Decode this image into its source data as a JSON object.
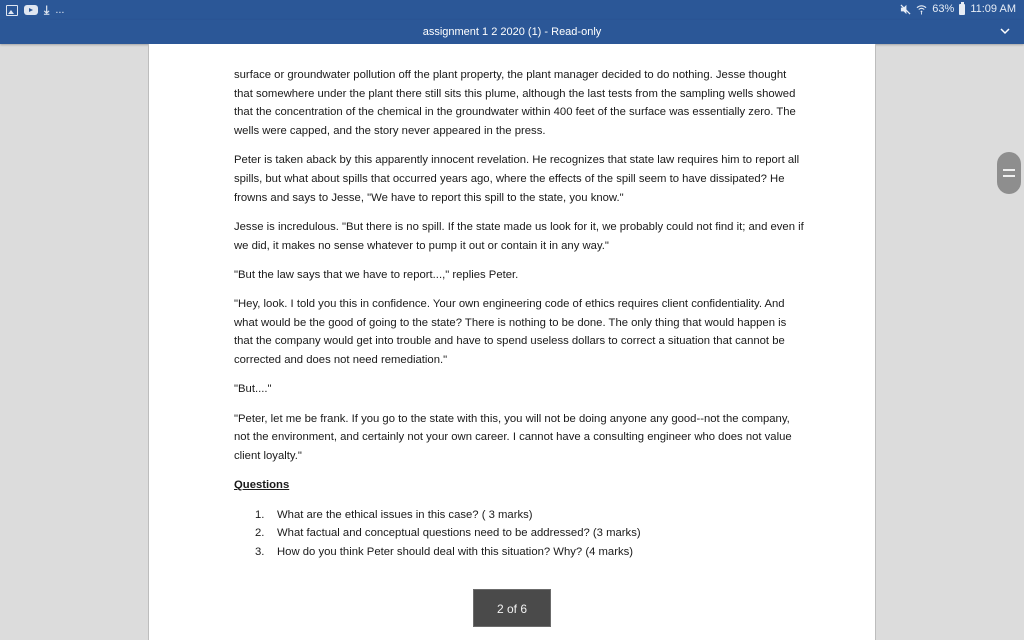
{
  "statusbar": {
    "left_icons": [
      "image-icon",
      "video-icon",
      "download-icon",
      "more-icon"
    ],
    "more_label": "...",
    "mute_glyph": "🔇",
    "battery_percent": "63%",
    "time": "11:09 AM"
  },
  "titlebar": {
    "title": "assignment 1  2 2020 (1) - Read-only"
  },
  "document": {
    "paragraphs": [
      "surface or groundwater pollution off the plant property, the plant manager decided to do nothing. Jesse thought that somewhere under the plant there still sits this plume, although the last tests from the sampling wells showed that the concentration of the chemical in the groundwater within 400 feet of the surface was essentially zero. The wells were capped, and the story never appeared in the press.",
      "Peter is taken aback by this apparently innocent revelation. He recognizes that state law requires him to report all spills, but what about spills that occurred years ago, where the effects of the spill seem to have dissipated? He frowns and says to Jesse, \"We have to report this spill to the state, you know.\"",
      "Jesse is incredulous. \"But there is no spill. If the state made us look for it, we probably could not find it; and even if we did, it makes no sense whatever to pump it out or contain it in any way.\"",
      "\"But the law says that we have to report...,\" replies Peter.",
      "\"Hey, look. I told you this in confidence. Your own engineering code of ethics requires client confidentiality. And what would be the good of going to the state? There is nothing to be done. The only thing that would happen is that the company would get into trouble and have to spend useless dollars to correct a situation that cannot be corrected and does not need remediation.\"",
      "\"But....\"",
      "\"Peter, let me be frank. If you go to the state with this, you will not be doing anyone any good--not the company, not the environment, and certainly not your own career. I cannot have a consulting engineer who does not value client loyalty.\""
    ],
    "questions_heading": "Questions",
    "questions": [
      {
        "num": "1.",
        "text": "What are the ethical issues in this case?  ( 3 marks)"
      },
      {
        "num": "2.",
        "text": "What factual and conceptual questions need to be addressed? (3 marks)"
      },
      {
        "num": "3.",
        "text": "How do you think Peter should deal with this situation? Why? (4 marks)"
      }
    ]
  },
  "page_indicator": {
    "label": "2 of 6",
    "current": 2,
    "total": 6
  }
}
